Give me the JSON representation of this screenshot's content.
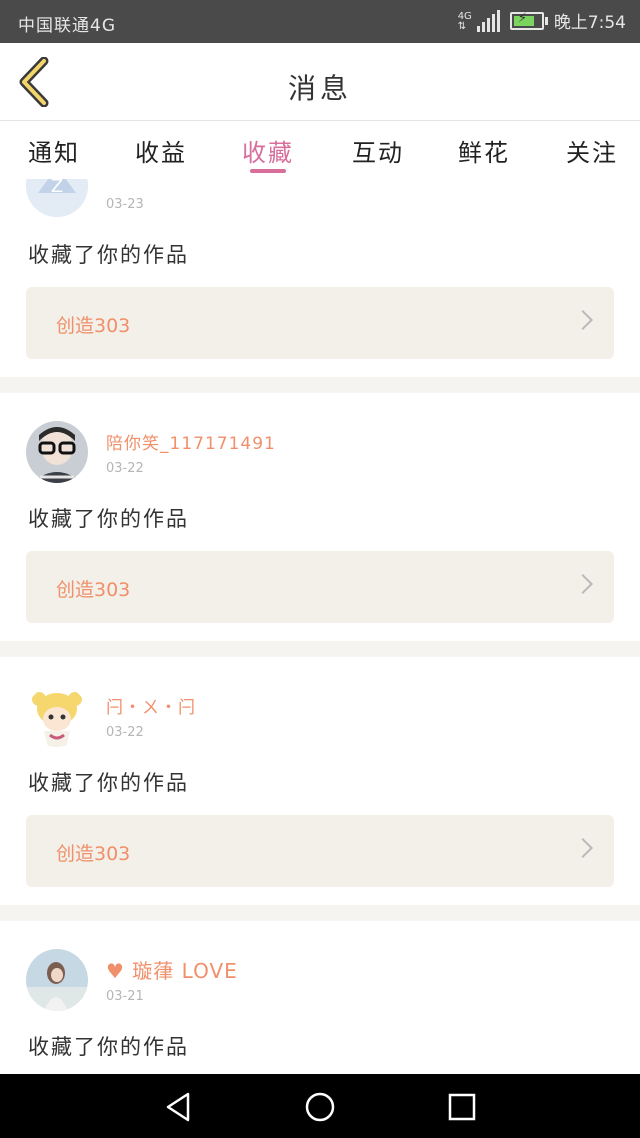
{
  "status_bar": {
    "carrier": "中国联通4G",
    "network": "4G",
    "time": "晚上7:54"
  },
  "header": {
    "title": "消息"
  },
  "tabs": [
    {
      "label": "通知"
    },
    {
      "label": "收益"
    },
    {
      "label": "收藏",
      "active": true
    },
    {
      "label": "互动"
    },
    {
      "label": "鲜花"
    },
    {
      "label": "关注"
    }
  ],
  "feed": [
    {
      "username": "",
      "date": "03-23",
      "action": "收藏了你的作品",
      "work_title": "创造303"
    },
    {
      "username": "陪你笑_117171491",
      "date": "03-22",
      "action": "收藏了你的作品",
      "work_title": "创造303"
    },
    {
      "username": "闩・ㄨ・闩",
      "date": "03-22",
      "action": "收藏了你的作品",
      "work_title": "创造303"
    },
    {
      "username": "璇葎 LOVE",
      "date": "03-21",
      "action": "收藏了你的作品",
      "work_title": ""
    }
  ],
  "colors": {
    "accent": "#d96e9c",
    "username": "#f0906b",
    "work_bg": "#f2f0e9"
  },
  "icons": [
    "back-chevron-icon",
    "signal-icon",
    "battery-icon",
    "heart-icon",
    "chevron-right-icon",
    "nav-back-icon",
    "nav-home-icon",
    "nav-recents-icon"
  ]
}
